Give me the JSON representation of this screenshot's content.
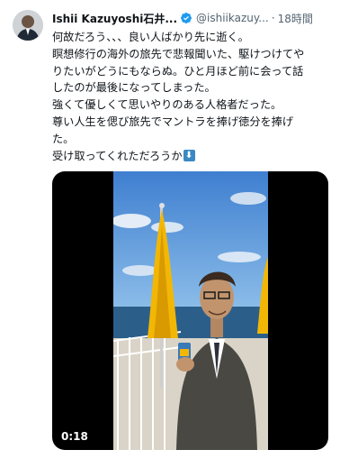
{
  "tweet": {
    "author_name": "Ishii Kazuyoshi石井...",
    "handle": "@ishiikazuy...",
    "separator": "·",
    "time": "18時間",
    "more_icon": "more-icon",
    "verified_icon": "verified-badge-icon",
    "lines": [
      "何故だろう、、、良い人ばかり先に逝く。",
      "瞑想修行の海外の旅先で悲報聞いた、駆けつけてや",
      "りたいがどうにもならぬ。ひと月ほど前に会って話",
      "したのが最後になってしまった。",
      "強くて優しくて思いやりのある人格者だった。",
      "尊い人生を偲び旅先でマントラを捧げ徳分を捧げ",
      "た。",
      "受け取ってくれただろうか"
    ],
    "emoji": "⬇️",
    "video_duration": "0:18"
  },
  "colors": {
    "text": "#0f1419",
    "secondary": "#536471",
    "verified": "#1d9bf0",
    "video_bg": "#000000",
    "umbrella": "#f2b705"
  }
}
